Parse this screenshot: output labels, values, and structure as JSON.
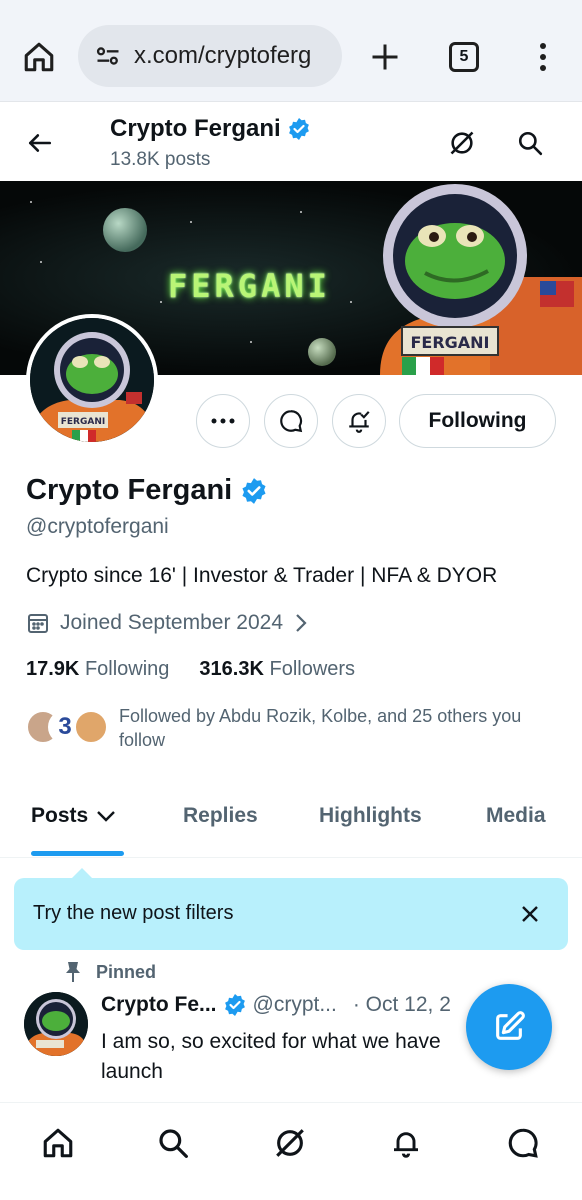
{
  "browser": {
    "url": "x.com/cryptoferg",
    "tab_count": "5",
    "icons": [
      "home-icon",
      "site-settings-icon",
      "new-tab-icon",
      "tabs-icon",
      "more-vert-icon"
    ]
  },
  "header": {
    "name": "Crypto Fergani",
    "posts": "13.8K posts"
  },
  "banner": {
    "text": "FERGANI"
  },
  "actions": {
    "follow_label": "Following"
  },
  "profile": {
    "name": "Crypto Fergani",
    "handle": "@cryptofergani",
    "bio": "Crypto since 16' | Investor & Trader | NFA & DYOR",
    "joined": "Joined September 2024",
    "following_count": "17.9K",
    "following_label": "Following",
    "followers_count": "316.3K",
    "followers_label": "Followers",
    "followed_by": "Followed by Abdu Rozik, Kolbe, and 25 others you follow"
  },
  "tabs": [
    {
      "label": "Posts"
    },
    {
      "label": "Replies"
    },
    {
      "label": "Highlights"
    },
    {
      "label": "Media"
    }
  ],
  "filter_tip": {
    "text": "Try the new post filters"
  },
  "post": {
    "pinned_label": "Pinned",
    "name": "Crypto Fe...",
    "handle": "@crypt...",
    "date": "· Oct 12, 2",
    "text": "I am so, so excited for what we have launch"
  },
  "colors": {
    "accent": "#1d9bf0",
    "verified": "#1d9bf0",
    "tip_bg": "#b8f0fc"
  }
}
